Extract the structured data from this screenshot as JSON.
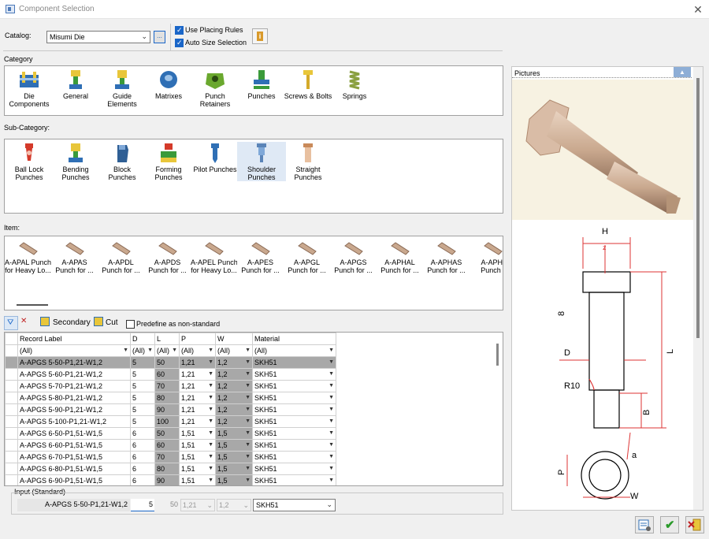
{
  "window": {
    "title": "Component Selection",
    "close": "✕"
  },
  "toolbar": {
    "catalog_label": "Catalog:",
    "catalog_value": "Misumi Die",
    "browse_label": "...",
    "use_placing_rules": "Use Placing Rules",
    "auto_size_selection": "Auto Size Selection",
    "info_label": "i"
  },
  "category": {
    "label": "Category",
    "items": [
      {
        "label": "Die\nComponents"
      },
      {
        "label": "General"
      },
      {
        "label": "Guide\nElements"
      },
      {
        "label": "Matrixes"
      },
      {
        "label": "Punch\nRetainers"
      },
      {
        "label": "Punches"
      },
      {
        "label": "Screws & Bolts"
      },
      {
        "label": "Springs"
      }
    ]
  },
  "subcategory": {
    "label": "Sub-Category:",
    "items": [
      {
        "label": "Ball Lock\nPunches"
      },
      {
        "label": "Bending\nPunches"
      },
      {
        "label": "Block\nPunches"
      },
      {
        "label": "Forming\nPunches"
      },
      {
        "label": "Pilot Punches"
      },
      {
        "label": "Shoulder\nPunches"
      },
      {
        "label": "Straight\nPunches"
      }
    ]
  },
  "items": {
    "label": "Item:",
    "list": [
      {
        "l1": "A-APAL Punch",
        "l2": "for Heavy Lo..."
      },
      {
        "l1": "A-APAS",
        "l2": "Punch for ..."
      },
      {
        "l1": "A-APDL",
        "l2": "Punch for ..."
      },
      {
        "l1": "A-APDS",
        "l2": "Punch for ..."
      },
      {
        "l1": "A-APEL Punch",
        "l2": "for Heavy Lo..."
      },
      {
        "l1": "A-APES",
        "l2": "Punch for ..."
      },
      {
        "l1": "A-APGL",
        "l2": "Punch for ..."
      },
      {
        "l1": "A-APGS",
        "l2": "Punch for ..."
      },
      {
        "l1": "A-APHAL",
        "l2": "Punch for ..."
      },
      {
        "l1": "A-APHAS",
        "l2": "Punch for ..."
      },
      {
        "l1": "A-APHI",
        "l2": "Punch f"
      }
    ]
  },
  "gridtools": {
    "secondary": "Secondary",
    "cut": "Cut",
    "predefine": "Predefine as non-standard"
  },
  "grid": {
    "headers": [
      "Record Label",
      "D",
      "L",
      "P",
      "W",
      "Material"
    ],
    "filters": [
      "(All)",
      "(All)",
      "(All)",
      "(All)",
      "(All)",
      "(All)"
    ],
    "rows": [
      [
        "A-APGS 5-50-P1,21-W1,2",
        "5",
        "50",
        "1,21",
        "1,2",
        "SKH51"
      ],
      [
        "A-APGS 5-60-P1,21-W1,2",
        "5",
        "60",
        "1,21",
        "1,2",
        "SKH51"
      ],
      [
        "A-APGS 5-70-P1,21-W1,2",
        "5",
        "70",
        "1,21",
        "1,2",
        "SKH51"
      ],
      [
        "A-APGS 5-80-P1,21-W1,2",
        "5",
        "80",
        "1,21",
        "1,2",
        "SKH51"
      ],
      [
        "A-APGS 5-90-P1,21-W1,2",
        "5",
        "90",
        "1,21",
        "1,2",
        "SKH51"
      ],
      [
        "A-APGS 5-100-P1,21-W1,2",
        "5",
        "100",
        "1,21",
        "1,2",
        "SKH51"
      ],
      [
        "A-APGS 6-50-P1,51-W1,5",
        "6",
        "50",
        "1,51",
        "1,5",
        "SKH51"
      ],
      [
        "A-APGS 6-60-P1,51-W1,5",
        "6",
        "60",
        "1,51",
        "1,5",
        "SKH51"
      ],
      [
        "A-APGS 6-70-P1,51-W1,5",
        "6",
        "70",
        "1,51",
        "1,5",
        "SKH51"
      ],
      [
        "A-APGS 6-80-P1,51-W1,5",
        "6",
        "80",
        "1,51",
        "1,5",
        "SKH51"
      ],
      [
        "A-APGS 6-90-P1,51-W1,5",
        "6",
        "90",
        "1,51",
        "1,5",
        "SKH51"
      ]
    ]
  },
  "input": {
    "label": "Input (Standard)",
    "record": "A-APGS 5-50-P1,21-W1,2",
    "d": "5",
    "l": "50",
    "p": "1,21",
    "w": "1,2",
    "material": "SKH51"
  },
  "pictures": {
    "label": "Pictures",
    "collapse": "▲",
    "dims": {
      "H": "H",
      "z": "z",
      "d8": "8",
      "D": "D",
      "L": "L",
      "R10": "R10",
      "B": "B",
      "a": "a",
      "P": "P",
      "W": "W"
    }
  }
}
